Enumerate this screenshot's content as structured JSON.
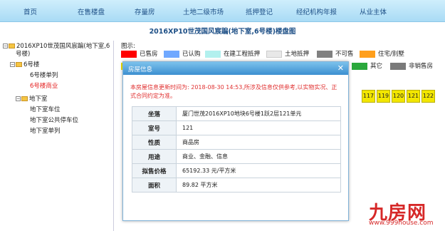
{
  "nav": {
    "items": [
      "首页",
      "在售楼盘",
      "存量房",
      "土地二级市场",
      "抵押登记",
      "经纪机构年报",
      "从业主体"
    ]
  },
  "page_title": "2016XP10世茂国风宸蹁(地下室,6号楼)楼盘图",
  "tree": {
    "root": "2016XP10世茂国风宸蹁(地下室,6",
    "root_cont": "号楼)",
    "building": "6号楼",
    "building_children": [
      "6号楼单列",
      "6号楼商业"
    ],
    "basement": "地下室",
    "basement_children": [
      "地下室车位",
      "地下室公共停车位",
      "地下室单列"
    ]
  },
  "legend": {
    "title": "图示:",
    "items": [
      {
        "label": "已售房",
        "color": "#ff0000"
      },
      {
        "label": "已认购",
        "color": "#6fa8ff"
      },
      {
        "label": "在建工程抵押",
        "color": "#b2f0ee"
      },
      {
        "label": "土地抵押",
        "color": "#e8e8e8"
      },
      {
        "label": "不可售",
        "color": "#808080"
      },
      {
        "label": "住宅/别墅",
        "color": "#ff9f1c"
      },
      {
        "label": "其它",
        "color": "#2aa83c"
      },
      {
        "label": "非销售房",
        "color": "#7a7a7a"
      }
    ]
  },
  "rooms": [
    "117",
    "119",
    "120",
    "121",
    "122"
  ],
  "room_color": "#f2e600",
  "dialog": {
    "title": "房屋信息",
    "close": "✕",
    "notice": "本房屋信息更新时间为: 2018-08-30 14:53,所涉及信息仅供参考,以实物实况、正式合同约定为准。",
    "rows": [
      {
        "key": "坐落",
        "value": "厦门世茂2016XP10地块6号楼1跃2层121单元"
      },
      {
        "key": "室号",
        "value": "121"
      },
      {
        "key": "性质",
        "value": "商品房"
      },
      {
        "key": "用途",
        "value": "商业、金融、信息"
      },
      {
        "key": "拟售价格",
        "value": "65192.33 元/平方米"
      },
      {
        "key": "面积",
        "value": "89.82 平方米"
      }
    ]
  },
  "watermark": {
    "brand": "九房网",
    "url": "www.999house.com"
  }
}
